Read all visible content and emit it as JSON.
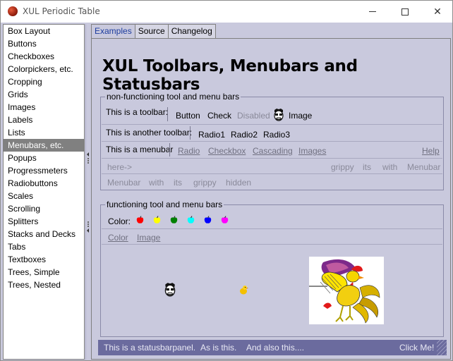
{
  "window": {
    "title": "XUL Periodic Table"
  },
  "sidebar": {
    "items": [
      {
        "label": "Box Layout"
      },
      {
        "label": "Buttons"
      },
      {
        "label": "Checkboxes"
      },
      {
        "label": "Colorpickers, etc."
      },
      {
        "label": "Cropping"
      },
      {
        "label": "Grids"
      },
      {
        "label": "Images"
      },
      {
        "label": "Labels"
      },
      {
        "label": "Lists"
      },
      {
        "label": "Menubars, etc."
      },
      {
        "label": "Popups"
      },
      {
        "label": "Progressmeters"
      },
      {
        "label": "Radiobuttons"
      },
      {
        "label": "Scales"
      },
      {
        "label": "Scrolling"
      },
      {
        "label": "Splitters"
      },
      {
        "label": "Stacks and Decks"
      },
      {
        "label": "Tabs"
      },
      {
        "label": "Textboxes"
      },
      {
        "label": "Trees, Simple"
      },
      {
        "label": "Trees, Nested"
      }
    ],
    "selected": "Menubars, etc."
  },
  "tabs": [
    {
      "label": "Examples",
      "active": true
    },
    {
      "label": "Source",
      "active": false
    },
    {
      "label": "Changelog",
      "active": false
    }
  ],
  "page": {
    "heading": "XUL Toolbars, Menubars and Statusbars"
  },
  "group1": {
    "caption": "non-functioning tool and menu bars",
    "toolbar1": {
      "label": "This is a toolbar:",
      "button": "Button",
      "check": "Check",
      "disabled": "Disabled",
      "image": "Image",
      "image_icon": "face-icon"
    },
    "toolbar2": {
      "label": "This is another toolbar:",
      "radio1": "Radio1",
      "radio2": "Radio2",
      "radio3": "Radio3"
    },
    "menubar": {
      "label": "This is a menubar",
      "radio": "Radio",
      "checkbox": "Checkbox",
      "cascading": "Cascading",
      "images": "Images",
      "help": "Help"
    },
    "row4": {
      "here": "here->",
      "grippy": "grippy",
      "its": "its",
      "with": "with",
      "menubar": "Menubar"
    },
    "row5": {
      "menubar": "Menubar",
      "with": "with",
      "its": "its",
      "grippy": "grippy",
      "hidden": "hidden"
    }
  },
  "group2": {
    "caption": "functioning tool and menu bars",
    "color_label": "Color:",
    "apple_colors": [
      "#ff0000",
      "#ffff00",
      "#008000",
      "#00ffff",
      "#0000ff",
      "#ff00ff"
    ],
    "menu": {
      "color": "Color",
      "image": "Image"
    },
    "canvas_icons": [
      "face-icon",
      "chick-icon",
      "rooster-image"
    ]
  },
  "statusbar": {
    "panel1": "This is a statusbarpanel.",
    "panel2": "As is this.",
    "panel3": "And also this....",
    "panel4": "Click Me!"
  },
  "colors": {
    "selection": "#808080",
    "statusbar": "#6b6b9e",
    "panel_bg": "#c9c9dd",
    "active_tab_text": "#1d3d9e"
  }
}
